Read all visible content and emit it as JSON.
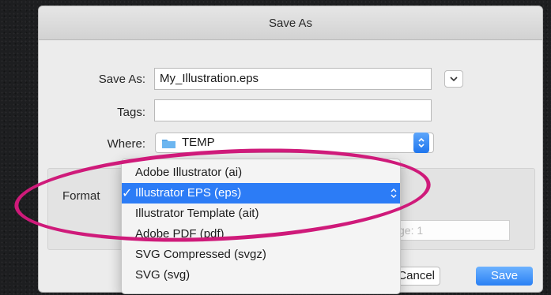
{
  "dialog": {
    "title": "Save As",
    "save_as_label": "Save As:",
    "filename": "My_Illustration.eps",
    "tags_label": "Tags:",
    "tags_value": "",
    "where_label": "Where:",
    "where_value": "TEMP",
    "format_label": "Format",
    "range_value": "ge: 1",
    "cancel_label": "Cancel",
    "save_label": "Save"
  },
  "format_menu": {
    "items": [
      "Adobe Illustrator (ai)",
      "Illustrator EPS (eps)",
      "Illustrator Template (ait)",
      "Adobe PDF (pdf)",
      "SVG Compressed (svgz)",
      "SVG (svg)"
    ],
    "selected_index": 1,
    "checkmark": "✓"
  },
  "colors": {
    "accent": "#2c7cf6",
    "highlight_ring": "#cf1a7a"
  },
  "icons": {
    "folder": "folder-icon",
    "expand": "chevron-down-icon",
    "where_stepper": "up-down-chevron-icon"
  }
}
